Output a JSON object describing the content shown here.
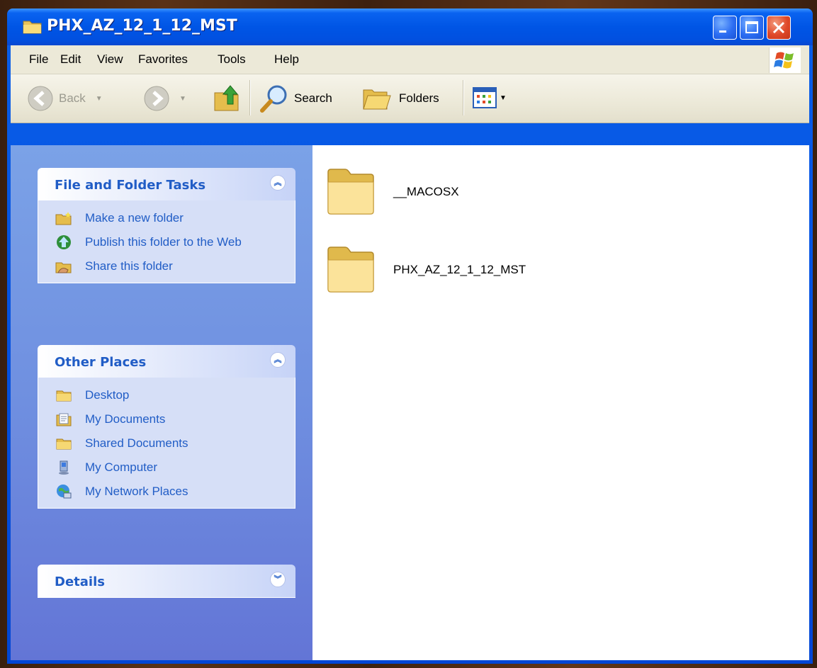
{
  "window": {
    "title": "PHX_AZ_12_1_12_MST"
  },
  "menu": [
    "File",
    "Edit",
    "View",
    "Favorites",
    "Tools",
    "Help"
  ],
  "toolbar": {
    "back_label": "Back",
    "search_label": "Search",
    "folders_label": "Folders"
  },
  "tasks_panel": {
    "title": "File and Folder Tasks",
    "items": [
      {
        "label": "Make a new folder",
        "icon": "new-folder-icon"
      },
      {
        "label": "Publish this folder to the Web",
        "icon": "publish-web-icon"
      },
      {
        "label": "Share this folder",
        "icon": "share-folder-icon"
      }
    ]
  },
  "places_panel": {
    "title": "Other Places",
    "items": [
      {
        "label": "Desktop",
        "icon": "folder-icon"
      },
      {
        "label": "My Documents",
        "icon": "documents-icon"
      },
      {
        "label": "Shared Documents",
        "icon": "folder-icon"
      },
      {
        "label": "My Computer",
        "icon": "computer-icon"
      },
      {
        "label": "My Network Places",
        "icon": "network-icon"
      }
    ]
  },
  "details_panel": {
    "title": "Details"
  },
  "files": [
    {
      "name": "__MACOSX",
      "icon": "folder-icon"
    },
    {
      "name": "PHX_AZ_12_1_12_MST",
      "icon": "folder-icon"
    }
  ],
  "colors": {
    "title_bar": "#0055e5",
    "side_pane": "#7ba2e7",
    "link_text": "#215dc6",
    "menu_bg": "#ece9d8"
  }
}
